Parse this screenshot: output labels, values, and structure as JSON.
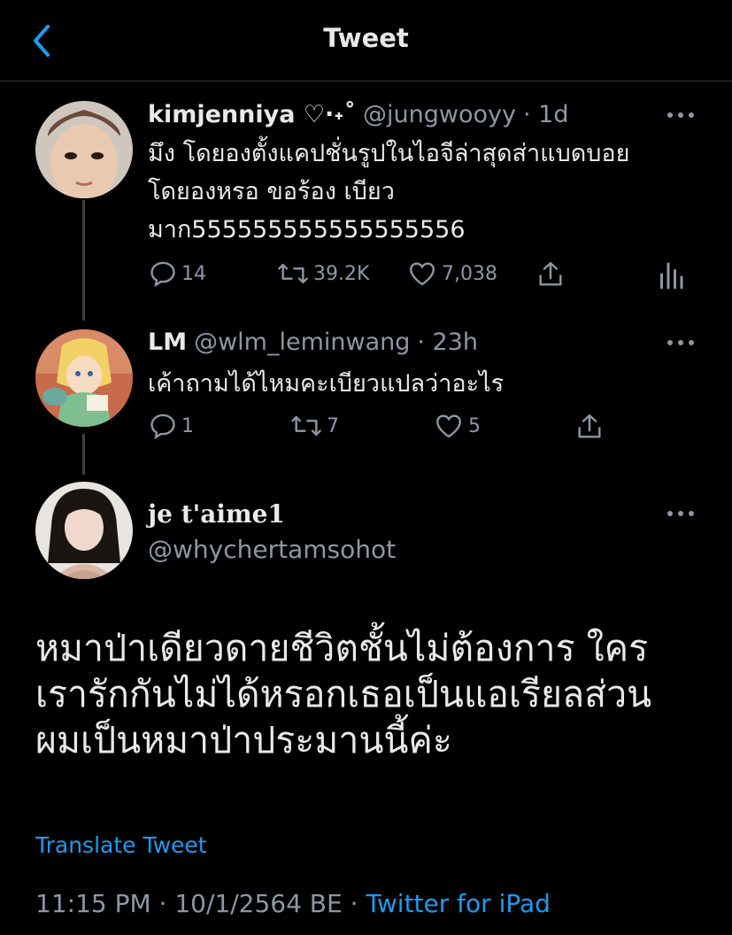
{
  "header": {
    "title": "Tweet",
    "back_icon": "chevron-left-icon"
  },
  "colors": {
    "background": "#000000",
    "link": "#1d9bf0",
    "muted": "#8b98a5",
    "text": "#e7e9ea"
  },
  "tweets": [
    {
      "name": "kimjenniya ♡·˖˚",
      "handle": "@jungwooyy",
      "time": "· 1d",
      "text_lines": [
        "มึง โดยองตั้งแคปชั่นรูปในไอจีล่าสุดส่าแบดบอย",
        "โดยองหรอ ขอร้อง เบียว",
        "มาก555555555555555556"
      ],
      "reply_count": "14",
      "retweet_count": "39.2K",
      "like_count": "7,038",
      "icons": [
        "reply-icon",
        "retweet-icon",
        "like-icon",
        "share-icon",
        "analytics-icon",
        "more-icon"
      ]
    },
    {
      "name": "LM",
      "handle": "@wlm_leminwang",
      "time": "· 23h",
      "text_lines": [
        "เค้าถามได้ไหมคะเบียวแปลว่าอะไร"
      ],
      "reply_count": "1",
      "retweet_count": "7",
      "like_count": "5",
      "icons": [
        "reply-icon",
        "retweet-icon",
        "like-icon",
        "share-icon",
        "more-icon"
      ]
    }
  ],
  "main_tweet": {
    "name": "je t'aime1",
    "handle": "@whychertamsohot",
    "text_lines": [
      "หมาป่าเดียวดายชีวิตชั้นไม่ต้องการ ใคร",
      "เรารักกันไม่ได้หรอกเธอเป็นแอเรียลส่วน",
      "ผมเป็นหมาป่าประมานนี้ค่ะ"
    ],
    "translate_label": "Translate Tweet",
    "timestamp": "11:15 PM · 10/1/2564 BE ·",
    "source": "Twitter for iPad"
  }
}
